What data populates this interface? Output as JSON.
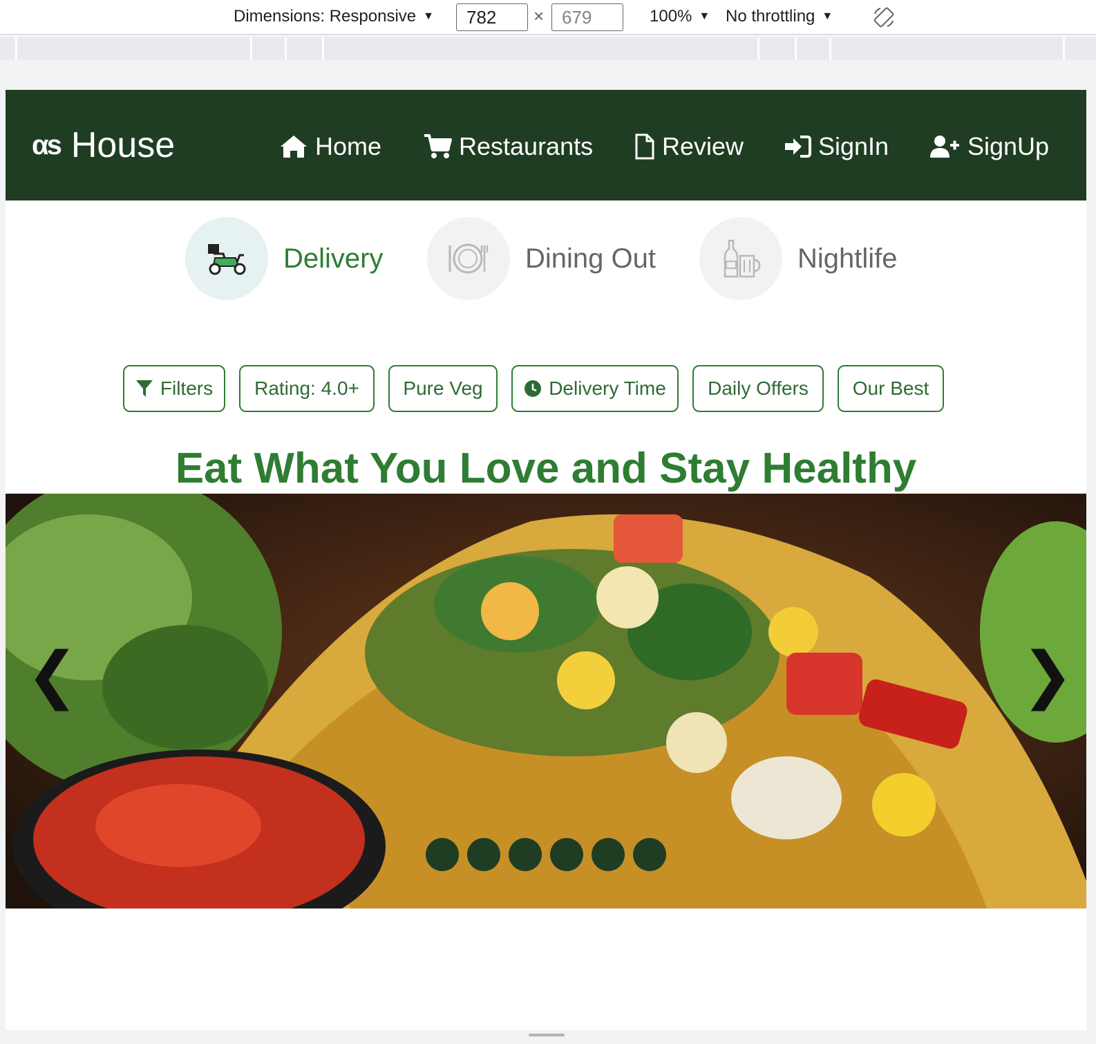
{
  "devtools": {
    "dimensions_label": "Dimensions: Responsive",
    "width_value": "782",
    "height_value": "679",
    "times": "×",
    "zoom": "100%",
    "throttling": "No throttling",
    "caret": "▼"
  },
  "navbar": {
    "brand_logo": "αs",
    "brand_name": "House",
    "items": [
      {
        "label": "Home",
        "icon": "home-icon"
      },
      {
        "label": "Restaurants",
        "icon": "cart-icon"
      },
      {
        "label": "Review",
        "icon": "document-icon"
      },
      {
        "label": "SignIn",
        "icon": "sign-in-icon"
      },
      {
        "label": "SignUp",
        "icon": "user-plus-icon"
      }
    ]
  },
  "modes": [
    {
      "label": "Delivery",
      "icon": "scooter-icon",
      "active": true
    },
    {
      "label": "Dining Out",
      "icon": "plate-icon",
      "active": false
    },
    {
      "label": "Nightlife",
      "icon": "bottle-icon",
      "active": false
    }
  ],
  "filters": [
    {
      "label": "Filters",
      "icon": "filter-icon"
    },
    {
      "label": "Rating: 4.0+"
    },
    {
      "label": "Pure Veg"
    },
    {
      "label": "Delivery Time",
      "icon": "clock-icon"
    },
    {
      "label": "Daily Offers"
    },
    {
      "label": "Our Best"
    }
  ],
  "headline": "Eat What You Love and Stay Healthy",
  "carousel": {
    "prev": "❮",
    "next": "❯",
    "slide_count": 6
  },
  "colors": {
    "primary_dark": "#1f3d23",
    "primary": "#2e7d32",
    "active_mode_bg": "#e6f1f1"
  }
}
